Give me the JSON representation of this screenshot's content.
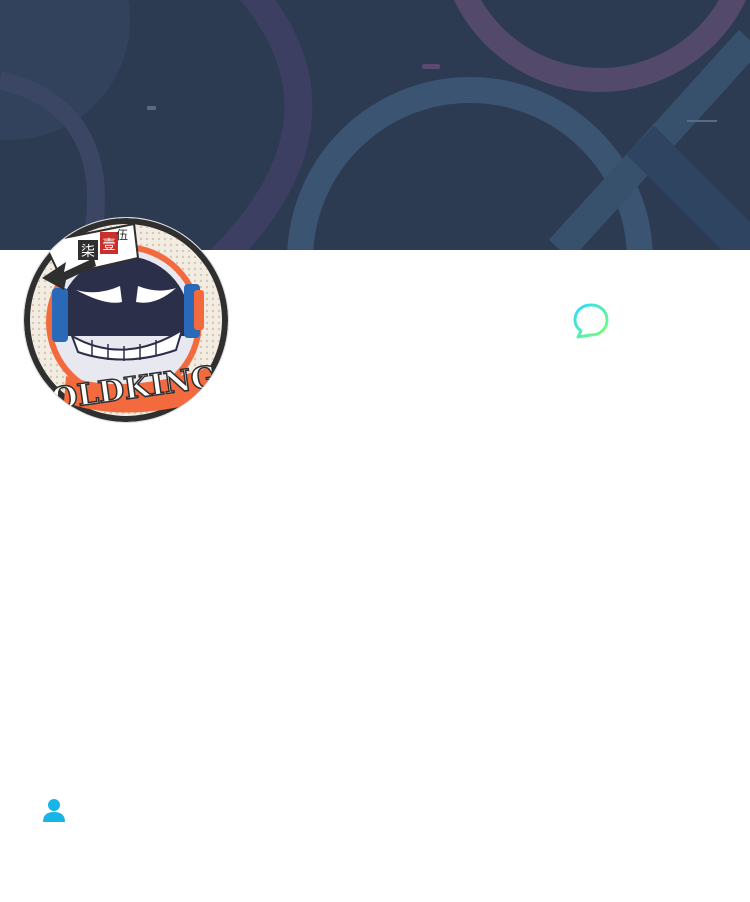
{
  "banner": {
    "background_color": "#2c3a52",
    "accent_color": "#5a4a72",
    "line_color": "#3e5a78"
  },
  "profile": {
    "avatar": {
      "logo_text": "OLDKING",
      "badge_chars": [
        "柒",
        "壹",
        "伍"
      ],
      "ring_color": "#f26a3e",
      "face_color": "#2b2f4a"
    },
    "name": "",
    "description": ""
  },
  "actions": {
    "chat_icon": "chat-bubble-icon",
    "chat_gradient": [
      "#2fd8ff",
      "#7cff6e"
    ]
  },
  "footer": {
    "user_icon": "user-icon",
    "user_icon_color": "#18b4e6",
    "user_label": ""
  }
}
